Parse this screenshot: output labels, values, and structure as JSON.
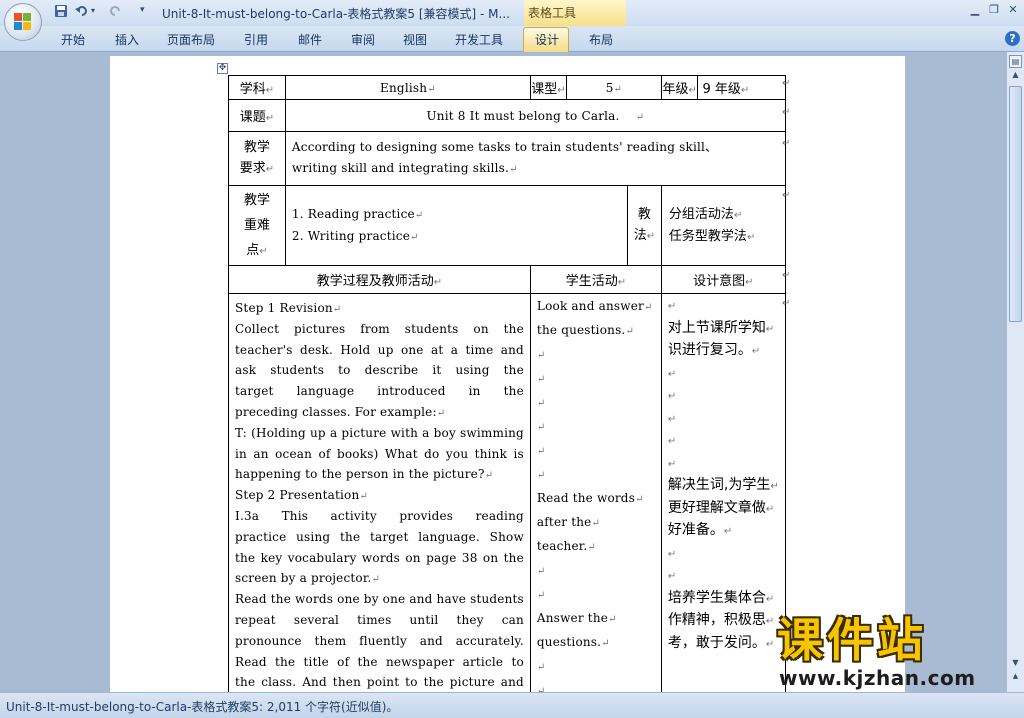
{
  "window": {
    "title": "Unit-8-It-must-belong-to-Carla-表格式教案5 [兼容模式] - M...",
    "context_tab": "表格工具"
  },
  "ribbon": {
    "tabs": [
      "开始",
      "插入",
      "页面布局",
      "引用",
      "邮件",
      "审阅",
      "视图",
      "开发工具",
      "设计",
      "布局"
    ],
    "active_tab": "设计"
  },
  "table": {
    "subject_label": "学科",
    "subject_value": "English",
    "lesson_label": "课型",
    "lesson_value": "5",
    "grade_label": "年级",
    "grade_value": "9 年级",
    "topic_label": "课题",
    "topic_value": "Unit 8 It must belong to Carla.",
    "req_label_1": "教学",
    "req_label_2": "要求",
    "req_line_1": "According to designing some tasks to  train students' reading skill、",
    "req_line_2": "writing skill and integrating skills.",
    "diff_label_1": "教学",
    "diff_label_2": "重难",
    "diff_label_3": "点",
    "diff_item_1": "1. Reading practice",
    "diff_item_2": "2. Writing practice",
    "method_label_1": "教",
    "method_label_2": "法",
    "method_value_1": "分组活动法",
    "method_value_2": "任务型教学法",
    "col_process": "教学过程及教师活动",
    "col_student": "学生活动",
    "col_intent": "设计意图",
    "process_lines": [
      "Step 1 Revision",
      "Collect pictures from students on the",
      "teacher's desk. Hold up one at a time and",
      "ask students to describe it using the",
      "target language introduced in the",
      "preceding classes. For example:",
      "T: (Holding up a picture with a boy swimming",
      "in an ocean of books) What do you think is",
      "happening to the person in the picture?",
      "Step 2  Presentation",
      "I.3a  This activity provides reading",
      "practice using the target language. Show",
      "the key vocabulary words on page 38 on the",
      "screen by a projector.",
      "Read the words one by one and have students",
      "repeat several times until they can",
      "pronounce them fluently and accurately.",
      "Read the title of the newspaper article to",
      "the class. And then point to the picture and"
    ],
    "student_lines": [
      "Look and answer",
      "the questions.",
      "",
      "",
      "",
      "",
      "",
      "",
      "Read the words",
      "after the",
      "teacher.",
      "",
      "",
      "Answer the",
      "questions.",
      "",
      ""
    ],
    "intent_lines": [
      "",
      "对上节课所学知",
      "识进行复习。",
      "",
      "",
      "",
      "",
      "",
      "解决生词,为学生",
      "更好理解文章做",
      "好准备。",
      "",
      "",
      "培养学生集体合",
      "作精神，积极思",
      "考，敢于发问。"
    ]
  },
  "status": {
    "text": "Unit-8-It-must-belong-to-Carla-表格式教案5: 2,011 个字符(近似值)。"
  },
  "watermark": {
    "cn": "课件站",
    "en": "www.kjzhan.com"
  }
}
